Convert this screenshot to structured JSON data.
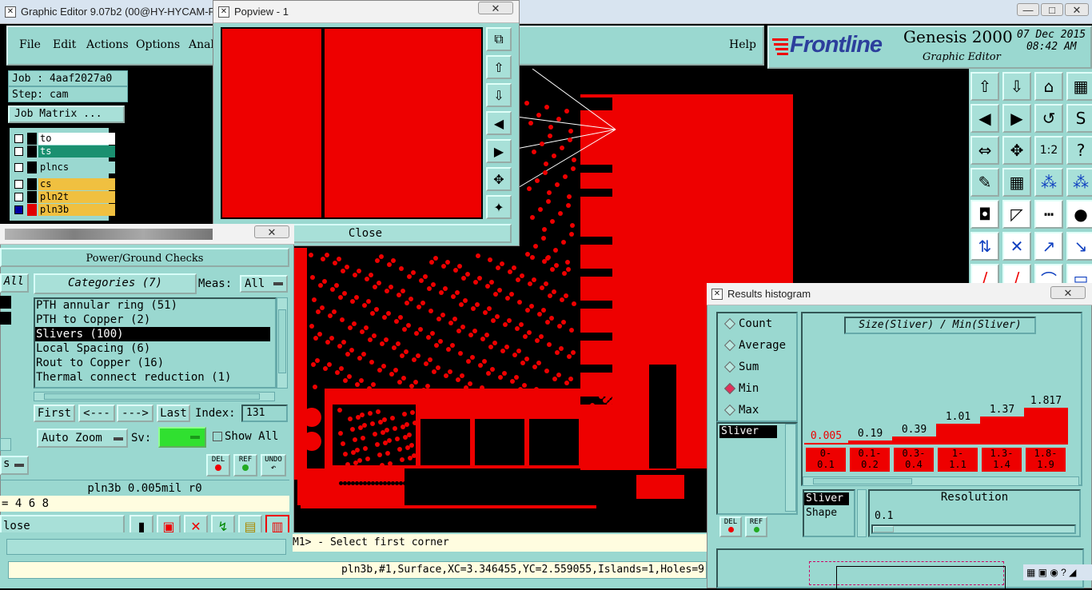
{
  "main_window": {
    "title": "Graphic Editor 9.07b2 (00@HY-HYCAM-F"
  },
  "menu": {
    "file": "File",
    "edit": "Edit",
    "actions": "Actions",
    "options": "Options",
    "analysis": "Anal",
    "help": "Help"
  },
  "brand": {
    "logo": "Frontline",
    "product": "Genesis 2000",
    "subtitle": "Graphic Editor",
    "date": "07 Dec 2015",
    "time": "08:42 AM"
  },
  "job": {
    "job_label": "Job : 4aaf2027a0",
    "step_label": "Step: cam",
    "matrix_button": "Job Matrix ..."
  },
  "layers": [
    {
      "name": "to",
      "color": "#ffffff",
      "swatch": "#000000"
    },
    {
      "name": "ts",
      "color": "#1a9070",
      "swatch": "#000000"
    },
    {
      "name": "plncs",
      "color": "#9ad8d0",
      "swatch": "#000000"
    },
    {
      "name": "cs",
      "color": "#f0c040",
      "swatch": "#000000"
    },
    {
      "name": "pln2t",
      "color": "#f0c040",
      "swatch": "#000000"
    },
    {
      "name": "pln3b",
      "color": "#f0c040",
      "swatch": "#e00000"
    }
  ],
  "popview": {
    "title": "Popview - 1",
    "close_label": "Close"
  },
  "pg_checks": {
    "title": "Power/Ground Checks",
    "all_left": "All",
    "categories_label": "Categories (7)",
    "meas_label": "Meas:",
    "meas_value": "All",
    "categories": [
      "PTH annular ring (51)",
      "PTH to Copper (2)",
      "Slivers (100)",
      "Local Spacing (6)",
      "Rout to Copper (16)",
      "Thermal connect reduction (1)"
    ],
    "selected_index": 2,
    "first": "First",
    "prev": "<---",
    "next": "--->",
    "last": "Last",
    "index_label": "Index:",
    "index_value": "131",
    "zoom": "Auto Zoom",
    "sv_label": "Sv:",
    "show_all": "Show All",
    "del": "DEL",
    "ref": "REF",
    "undo": "UNDO",
    "status": "pln3b 0.005mil  r0",
    "values": "= 4 6 8",
    "close": "lose",
    "s_left": "s"
  },
  "prompt": {
    "text": "M1> - Select first corner"
  },
  "status_bar": {
    "text": "pln3b,#1,Surface,XC=3.346455,YC=2.559055,Islands=1,Holes=9"
  },
  "histogram": {
    "title": "Results histogram",
    "radios": [
      "Count",
      "Average",
      "Sum",
      "Min",
      "Max"
    ],
    "selected_radio": "Min",
    "list_item": "Sliver",
    "chart_title": "Size(Sliver) / Min(Sliver)",
    "bins": [
      {
        "value": "0.005",
        "range": "0-\n0.1",
        "v": 0.005
      },
      {
        "value": "0.19",
        "range": "0.1-\n0.2",
        "v": 0.19
      },
      {
        "value": "0.39",
        "range": "0.3-\n0.4",
        "v": 0.39
      },
      {
        "value": "1.01",
        "range": "1-\n1.1",
        "v": 1.01
      },
      {
        "value": "1.37",
        "range": "1.3-\n1.4",
        "v": 1.37
      },
      {
        "value": "1.817",
        "range": "1.8-\n1.9",
        "v": 1.817
      }
    ],
    "type_label": "Sliver",
    "shape_label": "Shape",
    "resolution_label": "Resolution",
    "resolution_value": "0.1",
    "del": "DEL",
    "ref": "REF"
  },
  "colors": {
    "teal": "#9ad8d0",
    "copper": "#e00000",
    "background": "#000000"
  }
}
